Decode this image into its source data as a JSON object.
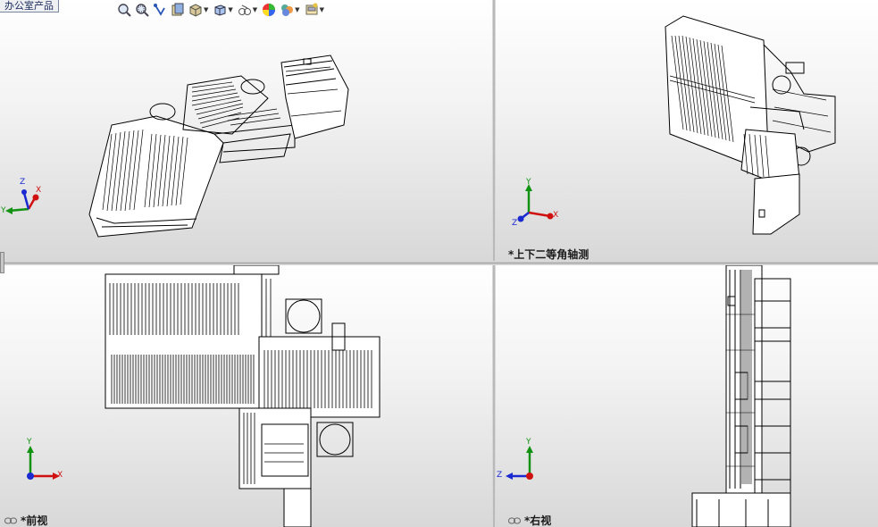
{
  "tab_label": "办公室产品",
  "toolbar": {
    "icons": [
      "zoom-to-fit-icon",
      "zoom-to-area-icon",
      "previous-view-icon",
      "section-view-icon",
      "view-orientation-icon",
      "display-style-icon",
      "hide-show-items-icon",
      "edit-appearance-icon",
      "apply-scene-icon",
      "view-settings-icon"
    ]
  },
  "viewports": {
    "top_left": {
      "label": ""
    },
    "top_right": {
      "label": "*上下二等角轴测"
    },
    "bottom_left": {
      "label": "*前视"
    },
    "bottom_right": {
      "label": "*右视"
    }
  },
  "axes": {
    "x": "X",
    "y": "Y",
    "z": "Z"
  },
  "colors": {
    "x_axis": "#d01010",
    "y_axis": "#129212",
    "z_axis": "#1a2ad0",
    "model_line": "#000000"
  }
}
